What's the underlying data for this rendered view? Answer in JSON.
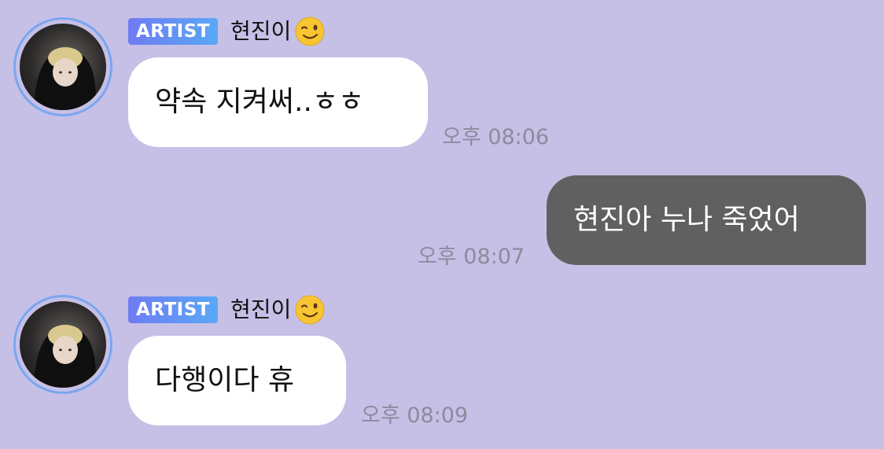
{
  "messages": [
    {
      "direction": "incoming",
      "badge": "ARTIST",
      "sender": "현진이",
      "sender_emoji": "wink-face-icon",
      "text": "약속 지켜써..ㅎㅎ",
      "time": "오후 08:06"
    },
    {
      "direction": "outgoing",
      "text": "현진아 누나 죽었어",
      "time": "오후 08:07"
    },
    {
      "direction": "incoming",
      "badge": "ARTIST",
      "sender": "현진이",
      "sender_emoji": "wink-face-icon",
      "text": "다행이다 휴",
      "time": "오후 08:09"
    }
  ],
  "theme": {
    "background": "#c6c0e6",
    "incoming_bubble": "#ffffff",
    "outgoing_bubble": "#606060",
    "badge_gradient": [
      "#6f7cf3",
      "#59a8f6"
    ],
    "avatar_ring": "#7aa6f0"
  }
}
